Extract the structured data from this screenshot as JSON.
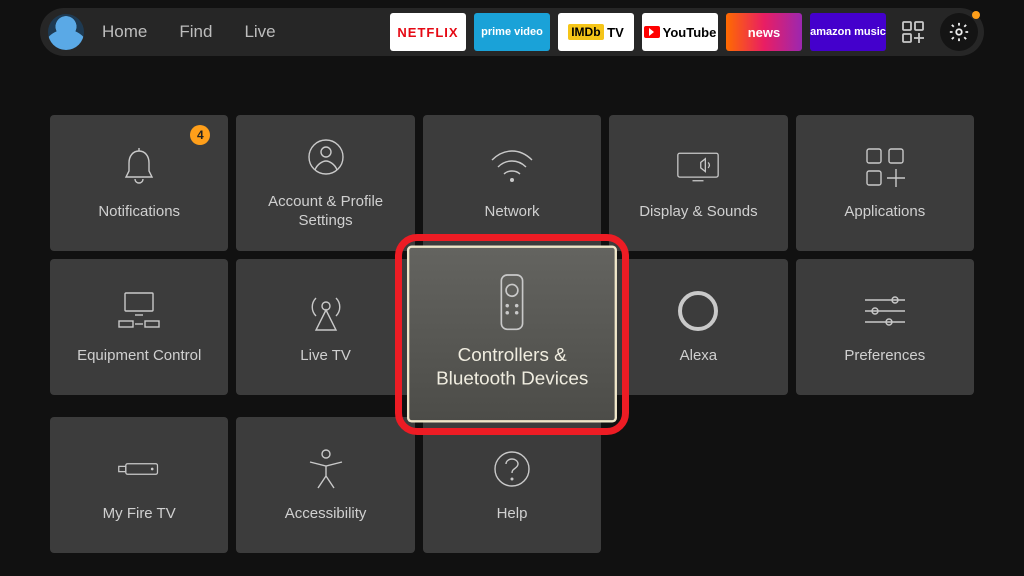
{
  "nav": {
    "items": [
      "Home",
      "Find",
      "Live"
    ],
    "apps": [
      "NETFLIX",
      "prime video",
      "IMDb TV",
      "YouTube",
      "news",
      "amazon music"
    ]
  },
  "settings": {
    "tiles": [
      {
        "id": "notifications",
        "label": "Notifications",
        "badge": "4"
      },
      {
        "id": "account",
        "label": "Account & Profile Settings"
      },
      {
        "id": "network",
        "label": "Network"
      },
      {
        "id": "display",
        "label": "Display & Sounds"
      },
      {
        "id": "applications",
        "label": "Applications"
      },
      {
        "id": "equipment",
        "label": "Equipment Control"
      },
      {
        "id": "livetv",
        "label": "Live TV"
      },
      {
        "id": "controllers",
        "label": "Controllers & Bluetooth Devices",
        "selected": true,
        "highlighted": true
      },
      {
        "id": "alexa",
        "label": "Alexa"
      },
      {
        "id": "preferences",
        "label": "Preferences"
      },
      {
        "id": "myfiretv",
        "label": "My Fire TV"
      },
      {
        "id": "accessibility",
        "label": "Accessibility"
      },
      {
        "id": "help",
        "label": "Help"
      }
    ]
  }
}
